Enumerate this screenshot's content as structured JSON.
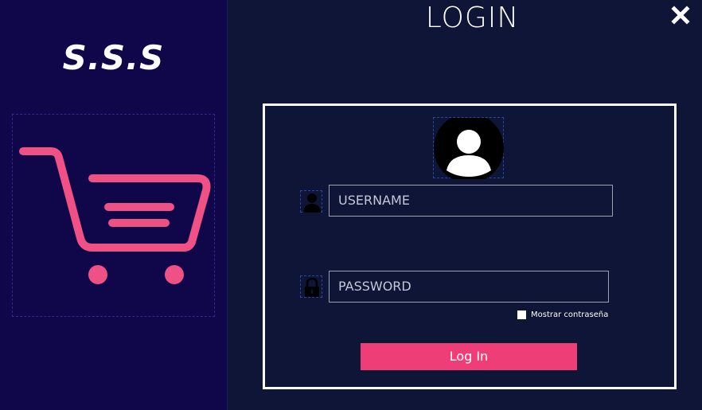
{
  "brand": {
    "name": "S.S.S"
  },
  "header": {
    "title": "LOGIN"
  },
  "form": {
    "username_placeholder": "USERNAME",
    "password_placeholder": "PASSWORD",
    "show_password_label": "Mostrar contraseña",
    "show_password_checked": false,
    "login_button_label": "Log In"
  },
  "icons": {
    "close": "close-icon",
    "cart": "shopping-cart-icon",
    "avatar": "user-avatar-icon",
    "user": "user-icon",
    "lock": "lock-icon"
  },
  "colors": {
    "left_panel_bg": "#10074a",
    "main_bg": "#0f1536",
    "accent": "#ef3d77",
    "text": "#ffffff"
  }
}
